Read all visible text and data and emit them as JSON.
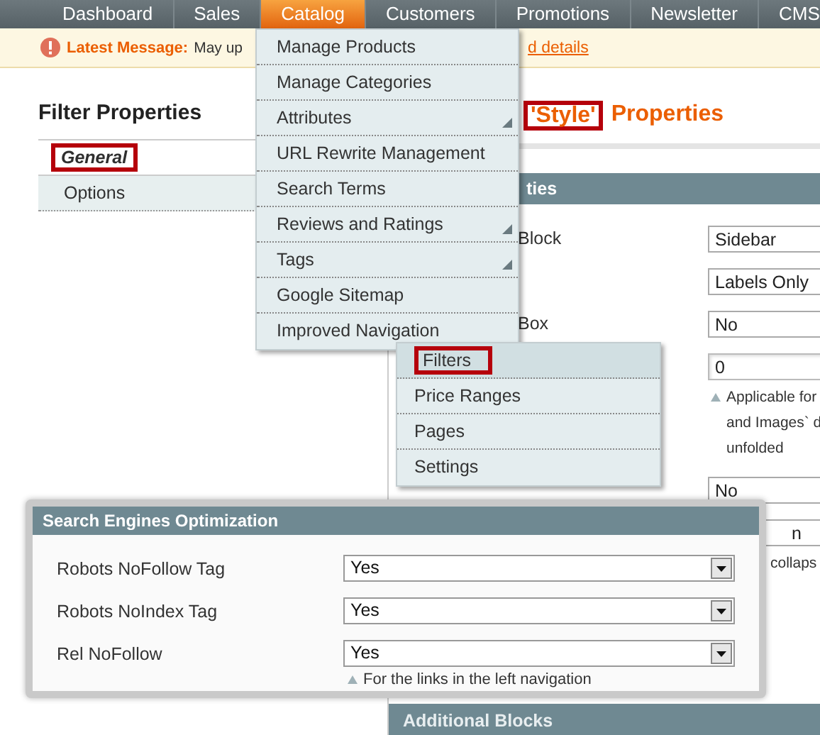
{
  "nav": {
    "tabs": [
      {
        "label": "Dashboard",
        "selected": false
      },
      {
        "label": "Sales",
        "selected": false
      },
      {
        "label": "Catalog",
        "selected": true
      },
      {
        "label": "Customers",
        "selected": false
      },
      {
        "label": "Promotions",
        "selected": false
      },
      {
        "label": "Newsletter",
        "selected": false
      },
      {
        "label": "CMS",
        "selected": false
      }
    ]
  },
  "message": {
    "title": "Latest Message:",
    "text": "May up",
    "link": "d details"
  },
  "sidebar": {
    "title": "Filter Properties",
    "items": [
      {
        "label": "General",
        "selected": true,
        "highlighted": true
      },
      {
        "label": "Options",
        "selected": false,
        "highlighted": false
      }
    ]
  },
  "content": {
    "heading": {
      "highlighted": "'Style'",
      "text": "Properties"
    },
    "section_title": "ties",
    "rows": [
      {
        "label": "Block",
        "kind": "select",
        "value": "Sidebar"
      },
      {
        "kind": "select",
        "value": "Labels Only"
      },
      {
        "label": "Box",
        "kind": "select",
        "value": "No"
      },
      {
        "kind": "text",
        "value": "0",
        "hint": [
          "Applicable for",
          "and Images` d",
          "unfolded"
        ]
      },
      {
        "kind": "select",
        "value": "No"
      },
      {
        "kind": "select",
        "value": "n",
        "clipped": true,
        "hint": [
          "collaps"
        ]
      }
    ],
    "next_section": "Additional Blocks"
  },
  "catalog_menu": {
    "items": [
      {
        "label": "Manage Products",
        "submenu": false
      },
      {
        "label": "Manage Categories",
        "submenu": false
      },
      {
        "label": "Attributes",
        "submenu": true
      },
      {
        "label": "URL Rewrite Management",
        "submenu": false
      },
      {
        "label": "Search Terms",
        "submenu": false
      },
      {
        "label": "Reviews and Ratings",
        "submenu": true
      },
      {
        "label": "Tags",
        "submenu": true
      },
      {
        "label": "Google Sitemap",
        "submenu": false
      },
      {
        "label": "Improved Navigation",
        "submenu": false
      }
    ]
  },
  "navigation_submenu": {
    "items": [
      {
        "label": "Filters",
        "selected": true,
        "highlighted": true
      },
      {
        "label": "Price Ranges",
        "selected": false,
        "highlighted": false
      },
      {
        "label": "Pages",
        "selected": false,
        "highlighted": false
      },
      {
        "label": "Settings",
        "selected": false,
        "highlighted": false
      }
    ]
  },
  "seo_panel": {
    "title": "Search Engines Optimization",
    "rows": [
      {
        "label": "Robots NoFollow Tag",
        "value": "Yes"
      },
      {
        "label": "Robots NoIndex Tag",
        "value": "Yes"
      },
      {
        "label": "Rel NoFollow",
        "value": "Yes"
      }
    ],
    "hint": "For the links in the left navigation"
  }
}
